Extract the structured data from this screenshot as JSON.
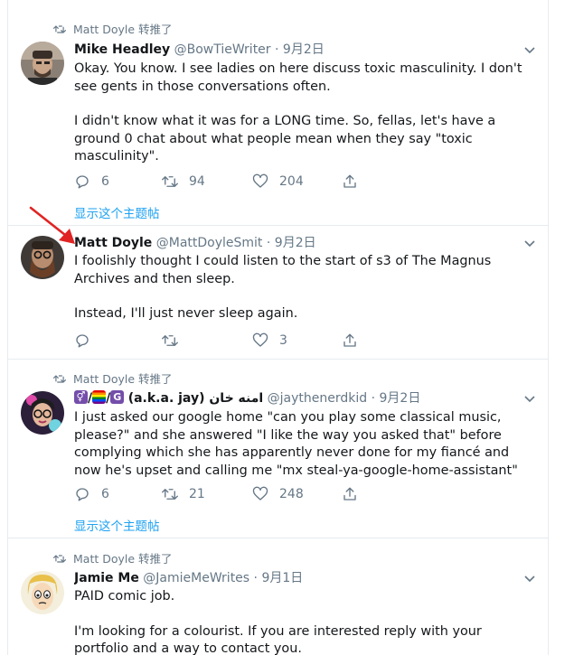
{
  "colors": {
    "link": "#1da1f2",
    "muted": "#657786",
    "text": "#14171a",
    "divider": "#e6ecf0",
    "pointer_arrow": "#e02424"
  },
  "icons": {
    "reply": "reply-icon",
    "retweet": "retweet-icon",
    "like": "heart-icon",
    "share": "share-icon",
    "more": "chevron-down-icon"
  },
  "tweets": [
    {
      "context": "Matt Doyle 转推了",
      "name": "Mike Headley",
      "handle": "@BowTieWriter",
      "dot": "·",
      "time": "9月2日",
      "paragraphs": [
        "Okay. You know. I see ladies on here discuss toxic masculinity. I don't see gents in those conversations often.",
        "I didn't know what it was for a LONG time. So, fellas, let's have a ground 0 chat about what people mean when they say \"toxic masculinity\"."
      ],
      "replies": "6",
      "retweets": "94",
      "likes": "204",
      "thread_link": "显示这个主题帖"
    },
    {
      "name": "Matt Doyle",
      "handle": "@MattDoyleSmit",
      "dot": "·",
      "time": "9月2日",
      "paragraphs": [
        "I foolishly thought I could listen to the start of s3 of The Magnus Archives and then sleep.",
        "Instead, I'll just never sleep again."
      ],
      "replies": "",
      "retweets": "",
      "likes": "3"
    },
    {
      "context": "Matt Doyle 转推了",
      "name_emoji": [
        "⚥",
        "🏳️‍🌈",
        "G"
      ],
      "name_sep": "/",
      "name": "(a.k.a. jay) امنه خان",
      "handle": "@jaythenerdkid",
      "dot": "·",
      "time": "9月2日",
      "paragraphs": [
        "I just asked our google home \"can you play some classical music, please?\" and she answered \"I like the way you asked that\" before complying which she has apparently never done for my fiancé and now he's upset and calling me \"mx steal-ya-google-home-assistant\""
      ],
      "replies": "6",
      "retweets": "21",
      "likes": "248",
      "thread_link": "显示这个主题帖"
    },
    {
      "context": "Matt Doyle 转推了",
      "name": "Jamie Me",
      "handle": "@JamieMeWrites",
      "dot": "·",
      "time": "9月1日",
      "paragraphs": [
        "PAID comic job.",
        "I'm looking for a colourist. If you are interested reply with your portfolio and a way to contact you."
      ]
    }
  ]
}
